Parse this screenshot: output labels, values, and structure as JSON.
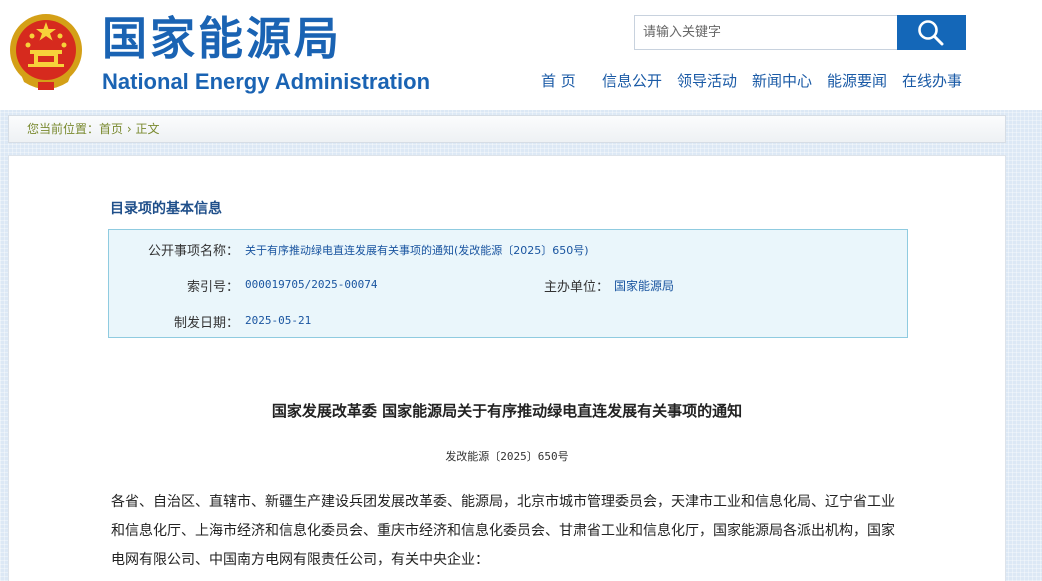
{
  "header": {
    "title_cn": "国家能源局",
    "title_en": "National Energy Administration",
    "emblem_icon": "national-emblem-icon"
  },
  "search": {
    "placeholder": "请输入关键字",
    "button_icon": "search-icon"
  },
  "nav": {
    "items": [
      "首 页",
      "信息公开",
      "领导活动",
      "新闻中心",
      "能源要闻",
      "在线办事"
    ]
  },
  "breadcrumb": {
    "prefix": "您当前位置：",
    "home": "首页",
    "separator": " › ",
    "current": "正文"
  },
  "info": {
    "heading": "目录项的基本信息",
    "name_label": "公开事项名称：",
    "name_value": "关于有序推动绿电直连发展有关事项的通知(发改能源〔2025〕650号)",
    "index_label": "索引号：",
    "index_value": "000019705/2025-00074",
    "org_label": "主办单位：",
    "org_value": "国家能源局",
    "date_label": "制发日期：",
    "date_value": "2025-05-21"
  },
  "document": {
    "title": "国家发展改革委 国家能源局关于有序推动绿电直连发展有关事项的通知",
    "number": "发改能源〔2025〕650号",
    "body": "各省、自治区、直辖市、新疆生产建设兵团发展改革委、能源局，北京市城市管理委员会，天津市工业和信息化局、辽宁省工业和信息化厅、上海市经济和信息化委员会、重庆市经济和信息化委员会、甘肃省工业和信息化厅，国家能源局各派出机构，国家电网有限公司、中国南方电网有限责任公司，有关中央企业："
  },
  "colors": {
    "brand_blue": "#1a63b3",
    "search_button": "#1467b8",
    "info_box_bg": "#eaf6fb",
    "info_box_border": "#8fcbe0",
    "breadcrumb_text": "#7a8a30"
  }
}
